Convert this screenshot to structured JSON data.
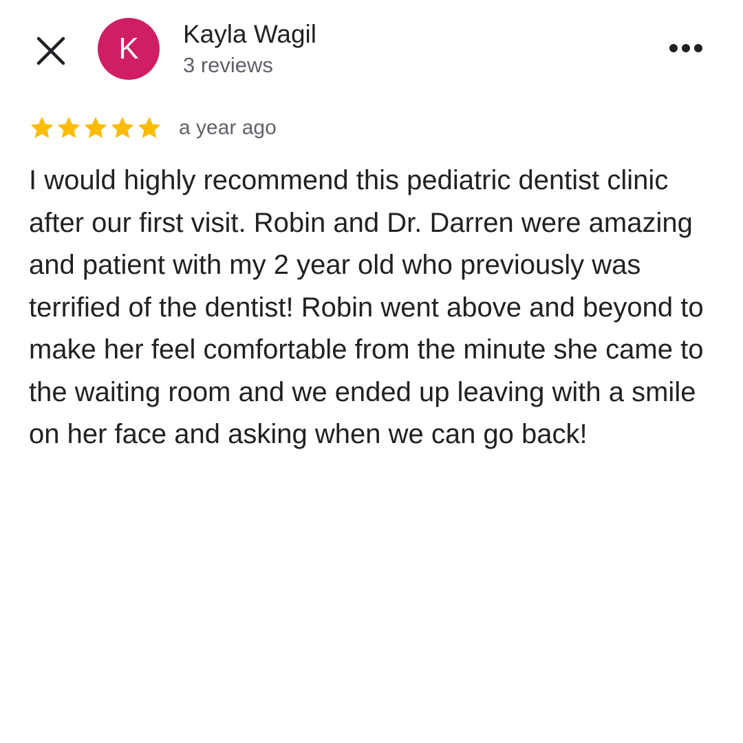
{
  "header": {
    "close_icon": "close-icon",
    "more_icon": "more-options-icon"
  },
  "author": {
    "avatar_letter": "K",
    "avatar_color": "#CF1E63",
    "name": "Kayla Wagil",
    "meta": "3 reviews"
  },
  "review": {
    "rating": 5,
    "max_rating": 5,
    "star_color": "#FBBC04",
    "time": "a year ago",
    "text": "I would highly recommend this pediatric dentist clinic after our first visit. Robin and Dr. Darren were amazing and patient with my 2 year old who previously was terrified of the dentist! Robin went above and beyond to make her feel comfortable from the minute she came to the waiting room and we ended up leaving with a smile on her face and asking when we can go back!"
  }
}
